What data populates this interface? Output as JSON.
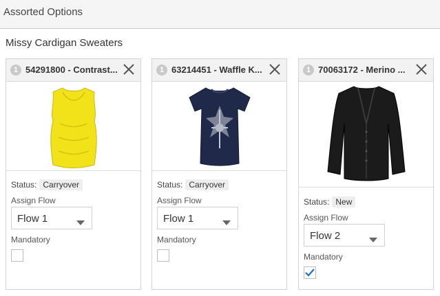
{
  "page": {
    "title": "Assorted Options"
  },
  "group": {
    "title": "Missy Cardigan Sweaters"
  },
  "labels": {
    "status": "Status:",
    "assign_flow": "Assign Flow",
    "mandatory": "Mandatory"
  },
  "colors": {
    "checkmark": "#1a73c9",
    "header_bg": "#f5f5f5",
    "card_border": "#d3d3d3"
  },
  "cards": [
    {
      "number": "1",
      "title": "54291800 - Contrast...",
      "status": "Carryover",
      "flow": "Flow 1",
      "mandatory": false,
      "image": "yellow-sleeveless-top"
    },
    {
      "number": "1",
      "title": "63214451 - Waffle K...",
      "status": "Carryover",
      "flow": "Flow 1",
      "mandatory": false,
      "image": "navy-graphic-tshirt"
    },
    {
      "number": "1",
      "title": "70063172 - Merino ...",
      "status": "New",
      "flow": "Flow 2",
      "mandatory": true,
      "image": "black-cardigan"
    }
  ]
}
